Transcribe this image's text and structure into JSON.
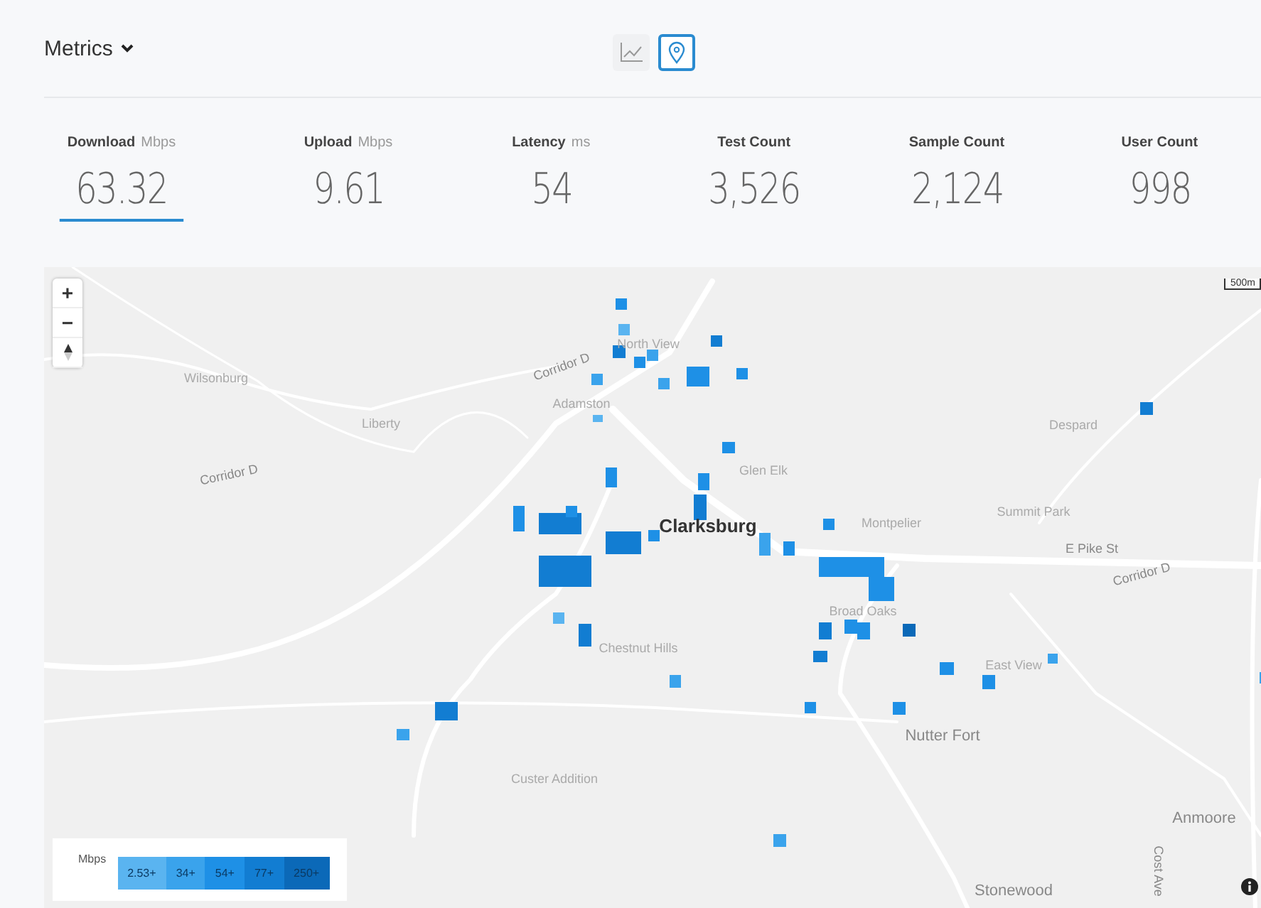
{
  "header": {
    "title": "Metrics",
    "views": [
      {
        "kind": "chart",
        "selected": false
      },
      {
        "kind": "map",
        "selected": true
      }
    ]
  },
  "stats": [
    {
      "label": "Download",
      "unit": "Mbps",
      "value": "63.32",
      "selected": true
    },
    {
      "label": "Upload",
      "unit": "Mbps",
      "value": "9.61",
      "selected": false
    },
    {
      "label": "Latency",
      "unit": "ms",
      "value": "54",
      "selected": false
    },
    {
      "label": "Test Count",
      "value": "3,526",
      "selected": false
    },
    {
      "label": "Sample Count",
      "value": "2,124",
      "selected": false
    },
    {
      "label": "User Count",
      "value": "998",
      "selected": false
    }
  ],
  "map": {
    "zoom_in": "+",
    "zoom_out": "−",
    "scale": "500m",
    "places": [
      {
        "name": "North View",
        "kind": "place"
      },
      {
        "name": "Wilsonburg",
        "kind": "place"
      },
      {
        "name": "Corridor D",
        "kind": "road"
      },
      {
        "name": "Adamston",
        "kind": "place"
      },
      {
        "name": "Liberty",
        "kind": "place"
      },
      {
        "name": "Despard",
        "kind": "place"
      },
      {
        "name": "Corridor D",
        "kind": "road"
      },
      {
        "name": "Glen Elk",
        "kind": "place"
      },
      {
        "name": "Clarksburg",
        "kind": "city"
      },
      {
        "name": "Montpelier",
        "kind": "place"
      },
      {
        "name": "Summit Park",
        "kind": "place"
      },
      {
        "name": "E Pike St",
        "kind": "road"
      },
      {
        "name": "Corridor D",
        "kind": "road"
      },
      {
        "name": "Broad Oaks",
        "kind": "place"
      },
      {
        "name": "Chestnut Hills",
        "kind": "place"
      },
      {
        "name": "East View",
        "kind": "place"
      },
      {
        "name": "Nutter Fort",
        "kind": "town"
      },
      {
        "name": "Custer Addition",
        "kind": "place"
      },
      {
        "name": "Anmoore",
        "kind": "town"
      },
      {
        "name": "Stonewood",
        "kind": "town"
      },
      {
        "name": "Cost Ave",
        "kind": "road"
      }
    ],
    "legend": {
      "unit": "Mbps",
      "bins": [
        {
          "label": "2.53+",
          "color": "#5ab4f0"
        },
        {
          "label": "34+",
          "color": "#3aa3ec"
        },
        {
          "label": "54+",
          "color": "#1e90e6"
        },
        {
          "label": "77+",
          "color": "#127dd2"
        },
        {
          "label": "250+",
          "color": "#0b69b8"
        }
      ]
    }
  }
}
